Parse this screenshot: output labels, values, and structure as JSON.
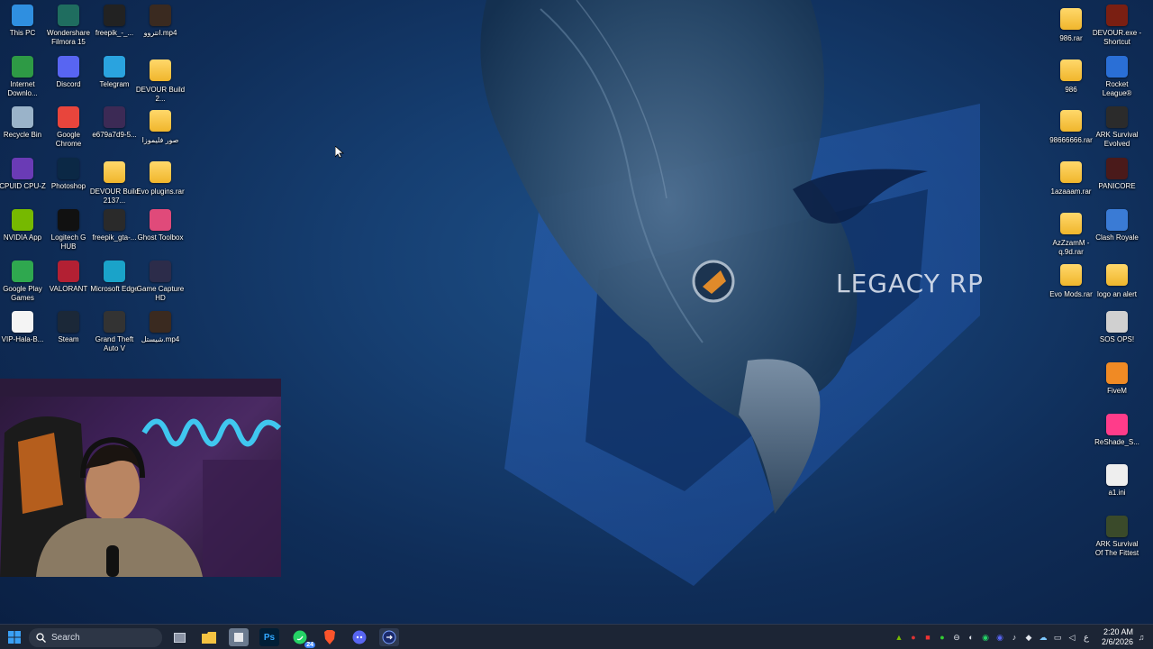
{
  "wallpaper": {
    "brand": "LEGACY RP"
  },
  "desktop_left": [
    {
      "label": "This PC",
      "icon": "monitor-icon",
      "color": "#2f8fe0"
    },
    {
      "label": "Wondershare Filmora 15",
      "icon": "filmora-icon",
      "color": "#1f6d5f"
    },
    {
      "label": "freepik_-_...",
      "icon": "video-thumb-icon",
      "color": "#222222"
    },
    {
      "label": "اتتروو.mp4",
      "icon": "video-thumb-icon",
      "color": "#3a2a20"
    },
    {
      "label": "Internet Downlo...",
      "icon": "idm-icon",
      "color": "#2e9a45"
    },
    {
      "label": "Discord",
      "icon": "discord-icon",
      "color": "#5865f2"
    },
    {
      "label": "Telegram",
      "icon": "telegram-icon",
      "color": "#2aa3df"
    },
    {
      "label": "DEVOUR Build 2...",
      "icon": "folder-icon",
      "color": "#f0b62c"
    },
    {
      "label": "Recycle Bin",
      "icon": "recycle-bin-icon",
      "color": "#9ab3c9"
    },
    {
      "label": "Google Chrome",
      "icon": "chrome-icon",
      "color": "#e8453c"
    },
    {
      "label": "e679a7d9-5...",
      "icon": "image-thumb-icon",
      "color": "#3c2a55"
    },
    {
      "label": "صور فليموزا",
      "icon": "folder-icon",
      "color": "#f0b62c"
    },
    {
      "label": "CPUID CPU-Z",
      "icon": "cpuz-icon",
      "color": "#6a3bb5"
    },
    {
      "label": "Photoshop",
      "icon": "photoshop-icon",
      "color": "#0b2845"
    },
    {
      "label": "DEVOUR Build 2137...",
      "icon": "folder-icon",
      "color": "#f0b62c"
    },
    {
      "label": "Evo plugins.rar",
      "icon": "folder-icon",
      "color": "#f0b62c"
    },
    {
      "label": "NVIDIA App",
      "icon": "nvidia-icon",
      "color": "#76b900"
    },
    {
      "label": "Logitech G HUB",
      "icon": "logitech-icon",
      "color": "#111111"
    },
    {
      "label": "freepik_gta-...",
      "icon": "image-thumb-icon",
      "color": "#2a2a2a"
    },
    {
      "label": "Ghost Toolbox",
      "icon": "ghost-toolbox-icon",
      "color": "#e04a7a"
    },
    {
      "label": "Google Play Games",
      "icon": "play-games-icon",
      "color": "#2fa84f"
    },
    {
      "label": "VALORANT",
      "icon": "valorant-icon",
      "color": "#b32033"
    },
    {
      "label": "Microsoft Edge",
      "icon": "edge-icon",
      "color": "#1aa3c9"
    },
    {
      "label": "Game Capture HD",
      "icon": "game-capture-icon",
      "color": "#2c2c4a"
    },
    {
      "label": "VIP-Hala-B...",
      "icon": "document-icon",
      "color": "#f4f4f4"
    },
    {
      "label": "Steam",
      "icon": "steam-icon",
      "color": "#1b2838"
    },
    {
      "label": "Grand Theft Auto V",
      "icon": "gta-icon",
      "color": "#333333"
    },
    {
      "label": "شيستل.mp4",
      "icon": "video-thumb-icon",
      "color": "#3a2a20"
    }
  ],
  "desktop_right": [
    {
      "label": "986.rar",
      "icon": "folder-icon",
      "color": "#f0b62c"
    },
    {
      "label": "DEVOUR.exe - Shortcut",
      "icon": "devour-icon",
      "color": "#7a1f12"
    },
    {
      "label": "986",
      "icon": "folder-icon",
      "color": "#f0b62c"
    },
    {
      "label": "Rocket League®",
      "icon": "rocket-league-icon",
      "color": "#2a6fd6"
    },
    {
      "label": "98666666.rar",
      "icon": "folder-icon",
      "color": "#f0b62c"
    },
    {
      "label": "ARK Survival Evolved",
      "icon": "ark-icon",
      "color": "#2b2b2b"
    },
    {
      "label": "1azaaam.rar",
      "icon": "folder-icon",
      "color": "#f0b62c"
    },
    {
      "label": "PANICORE",
      "icon": "panicore-icon",
      "color": "#4a1a1a"
    },
    {
      "label": "AzZzamM - q.9d.rar",
      "icon": "folder-icon",
      "color": "#f0b62c"
    },
    {
      "label": "Clash Royale",
      "icon": "clash-royale-icon",
      "color": "#3a7bd5"
    },
    {
      "label": "Evo Mods.rar",
      "icon": "folder-icon",
      "color": "#f0b62c"
    },
    {
      "label": "logo an alert",
      "icon": "folder-icon",
      "color": "#f0b62c"
    },
    {
      "label": "SOS OPS!",
      "icon": "sos-icon",
      "color": "#d0d0d0"
    },
    {
      "label": "FiveM",
      "icon": "fivem-icon",
      "color": "#f08a24"
    },
    {
      "label": "ReShade_S...",
      "icon": "reshade-icon",
      "color": "#ff3c8a"
    },
    {
      "label": "a1.ini",
      "icon": "ini-file-icon",
      "color": "#eeeeee"
    },
    {
      "label": "ARK Survival Of The Fittest",
      "icon": "ark-icon",
      "color": "#3a4a2a"
    }
  ],
  "taskbar": {
    "search_placeholder": "Search",
    "whatsapp_badge": "24",
    "clock_time": "2:20 AM",
    "clock_date": "2/6/2026",
    "input_indicator": "ع"
  }
}
